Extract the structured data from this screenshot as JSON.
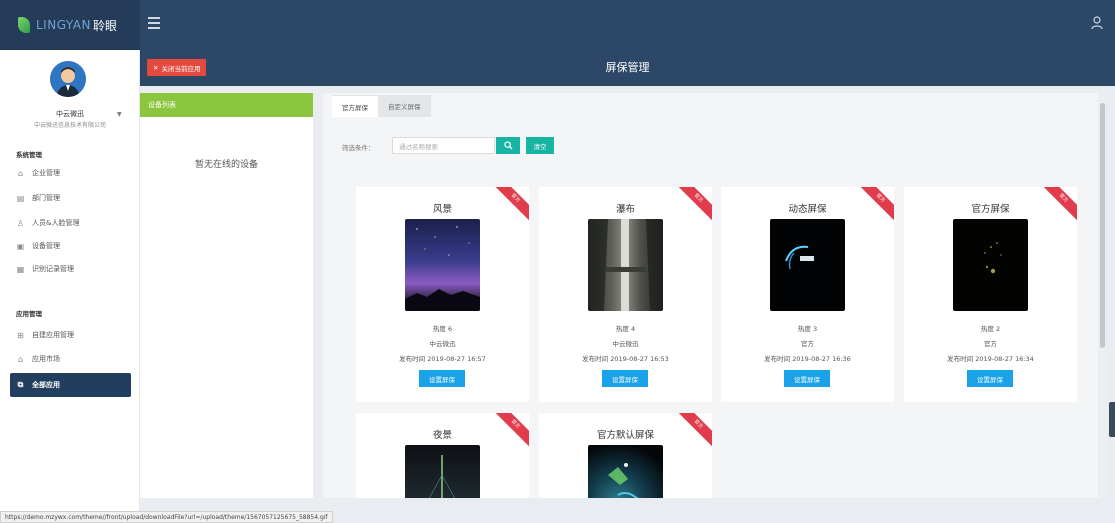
{
  "header": {
    "logo_text": "LINGYAN",
    "logo_cn": "聆眼",
    "colors": {
      "topbar": "#2c4866",
      "accent_green": "#8cc63f",
      "danger": "#e34a3d",
      "primary": "#1aa2e8",
      "teal": "#17b3a3"
    }
  },
  "sidebar": {
    "username": "中云微迅",
    "company": "中云微迅信息技术有限公司",
    "section1": "系统管理",
    "items1": [
      {
        "label": "企业管理",
        "icon": "home-icon"
      },
      {
        "label": "部门管理",
        "icon": "department-icon"
      },
      {
        "label": "人员&人脸管理",
        "icon": "person-icon"
      },
      {
        "label": "设备管理",
        "icon": "device-icon"
      },
      {
        "label": "识别记录管理",
        "icon": "record-icon"
      }
    ],
    "section2": "应用管理",
    "items2": [
      {
        "label": "自建应用管理",
        "icon": "grid-icon"
      },
      {
        "label": "应用市场",
        "icon": "market-icon"
      }
    ],
    "active_item": {
      "label": "全部应用",
      "icon": "cube-icon"
    }
  },
  "page": {
    "close_app_label": "关闭当前应用",
    "title": "屏保管理"
  },
  "device_panel": {
    "header": "设备列表",
    "empty_text": "暂无在线的设备"
  },
  "main": {
    "tabs": [
      {
        "label": "官方屏保",
        "active": true
      },
      {
        "label": "自定义屏保",
        "active": false
      }
    ],
    "filter_label": "筛选条件：",
    "search_placeholder": "通过名称搜索",
    "clear_label": "清空",
    "set_label": "设置屏保",
    "ribbon_label": "官方",
    "cards": [
      {
        "title": "风景",
        "heat": "热度 6",
        "author": "中云微迅",
        "published": "发布时间 2019-08-27 16:57"
      },
      {
        "title": "瀑布",
        "heat": "热度 4",
        "author": "中云微迅",
        "published": "发布时间 2019-08-27 16:53"
      },
      {
        "title": "动态屏保",
        "heat": "热度 3",
        "author": "官方",
        "published": "发布时间 2019-08-27 16:36"
      },
      {
        "title": "官方屏保",
        "heat": "热度 2",
        "author": "官方",
        "published": "发布时间 2019-08-27 16:34"
      },
      {
        "title": "夜景"
      },
      {
        "title": "官方默认屏保"
      }
    ]
  },
  "status_url": "https://demo.mzywx.com/theme//front/upload/downloadFile?url=/upload/theme/1567057125675_58854.gif"
}
